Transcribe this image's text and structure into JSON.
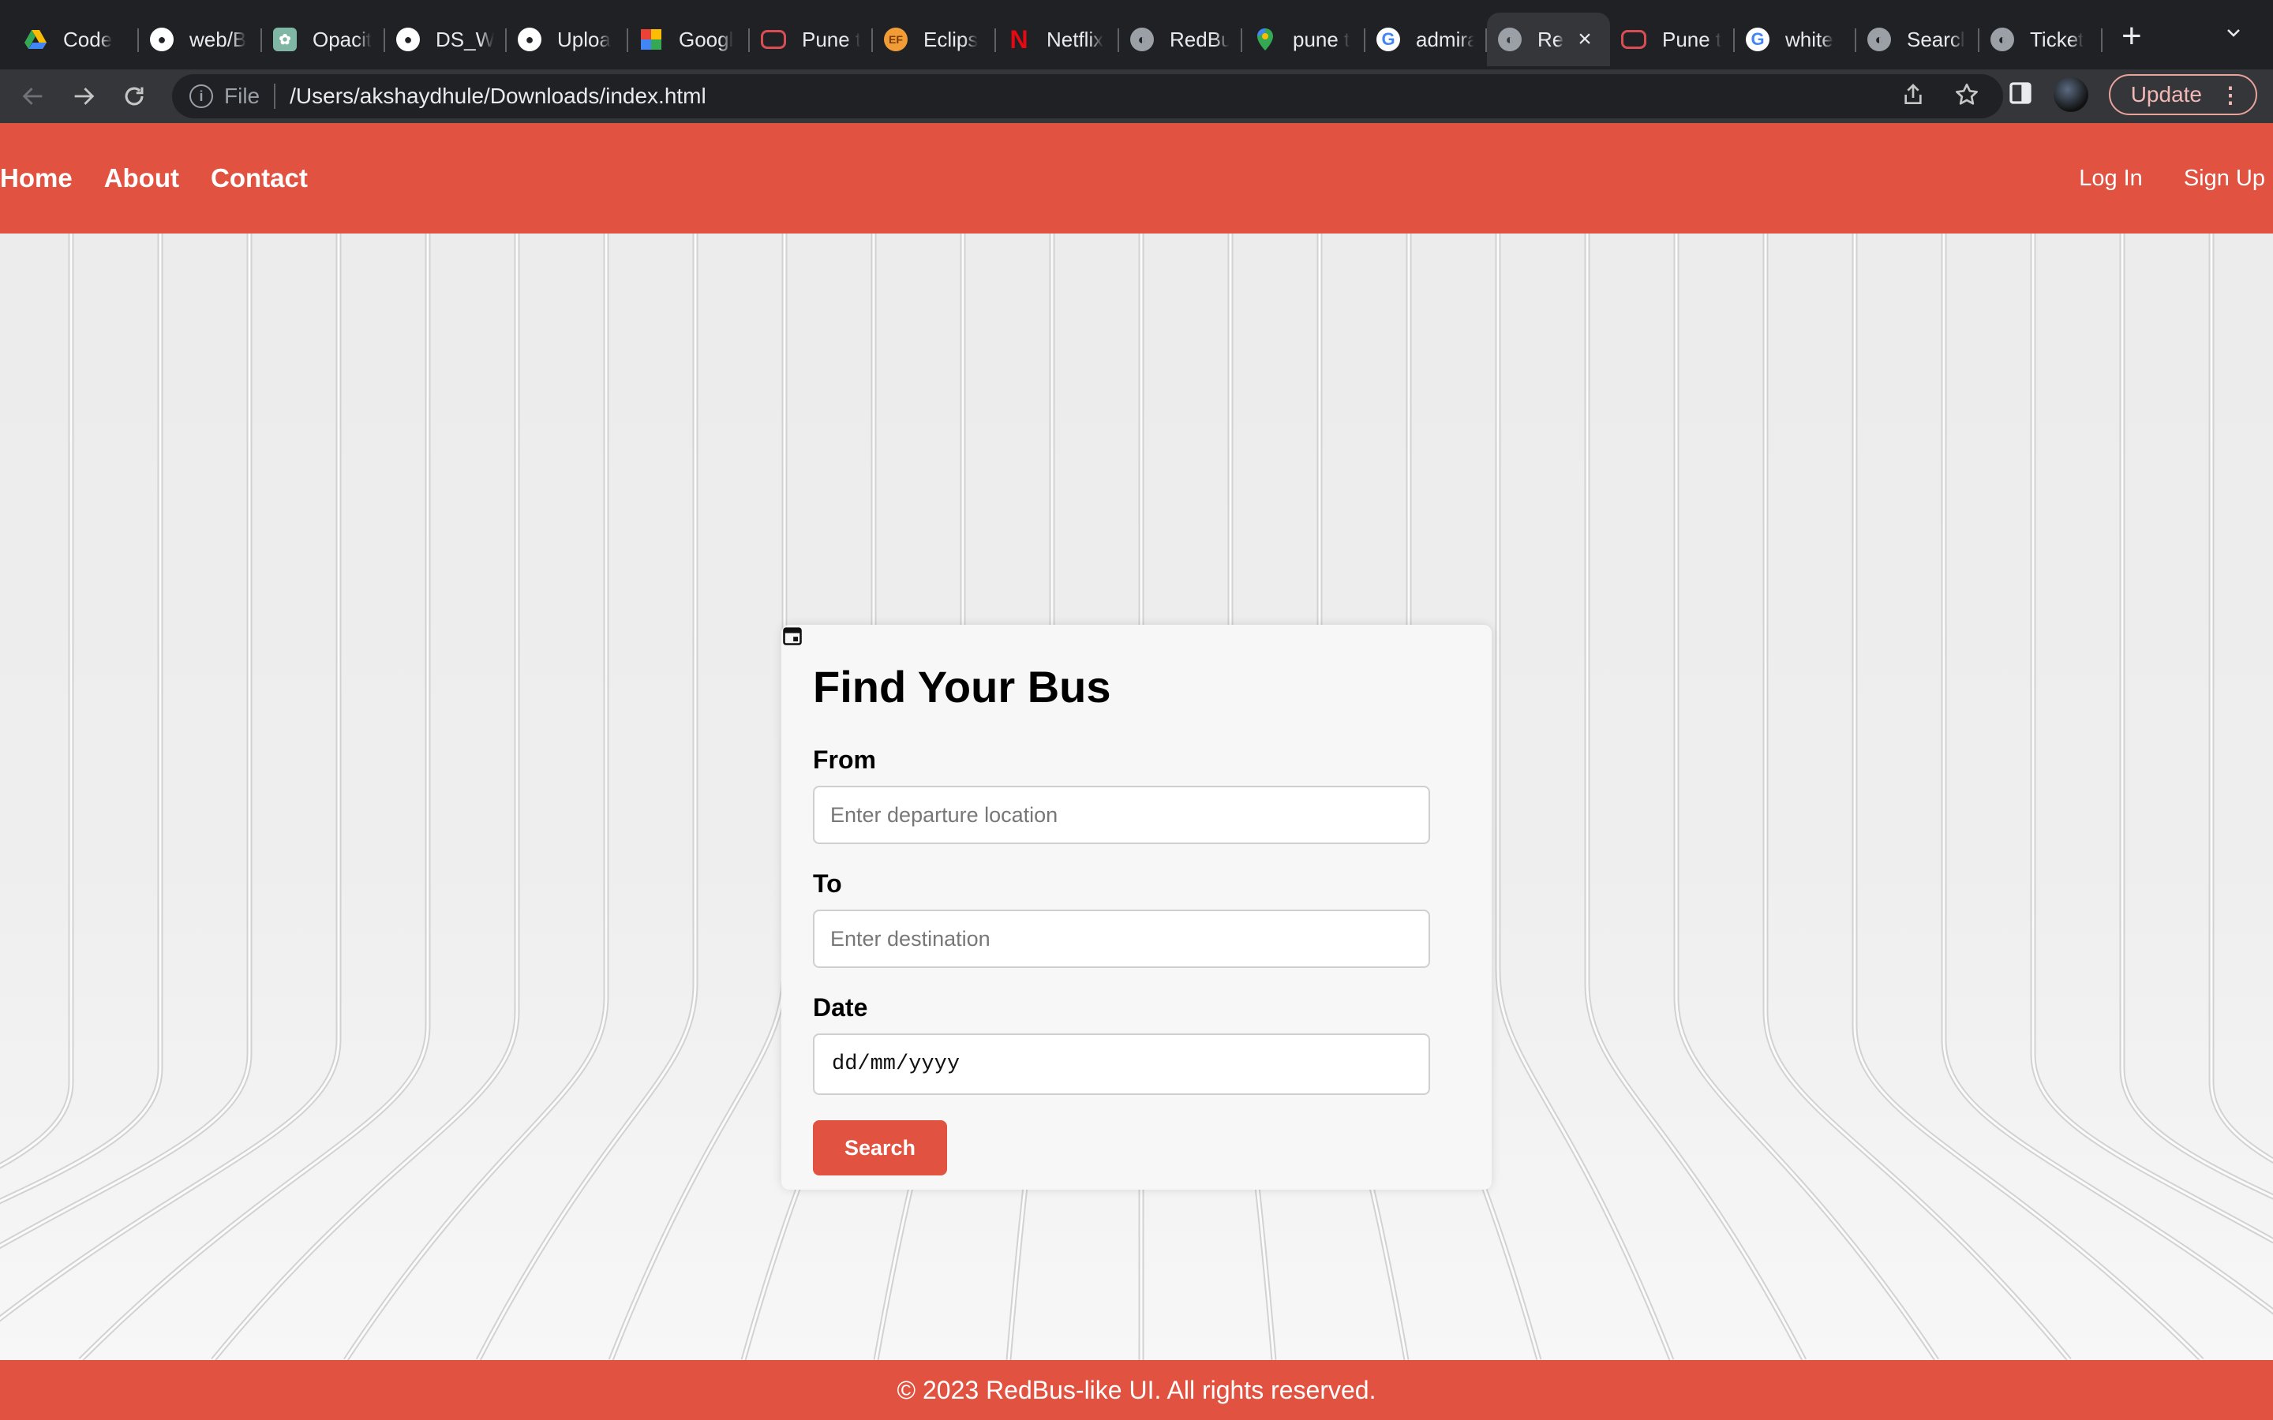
{
  "browser": {
    "tabs": [
      {
        "title": "Code",
        "favicon": "google-drive-icon"
      },
      {
        "title": "web/B",
        "favicon": "github-icon"
      },
      {
        "title": "Opacit",
        "favicon": "openai-icon"
      },
      {
        "title": "DS_W",
        "favicon": "github-icon"
      },
      {
        "title": "Uploa",
        "favicon": "github-icon"
      },
      {
        "title": "Googl",
        "favicon": "google-photos-icon"
      },
      {
        "title": "Pune t",
        "favicon": "redbus-icon"
      },
      {
        "title": "Eclips",
        "favicon": "eclipse-icon"
      },
      {
        "title": "Netflix",
        "favicon": "netflix-icon"
      },
      {
        "title": "RedBu",
        "favicon": "globe-icon"
      },
      {
        "title": "pune t",
        "favicon": "google-maps-icon"
      },
      {
        "title": "admira",
        "favicon": "google-icon"
      },
      {
        "title": "Re",
        "favicon": "globe-icon",
        "active": true
      },
      {
        "title": "Pune t",
        "favicon": "redbus-icon"
      },
      {
        "title": "white",
        "favicon": "google-icon"
      },
      {
        "title": "Searcl",
        "favicon": "globe-icon"
      },
      {
        "title": "Ticket",
        "favicon": "globe-icon"
      }
    ],
    "address": {
      "scheme_label": "File",
      "url": "/Users/akshaydhule/Downloads/index.html"
    },
    "update_label": "Update"
  },
  "site": {
    "nav_left": [
      "Home",
      "About",
      "Contact"
    ],
    "nav_right": [
      "Log In",
      "Sign Up"
    ],
    "form": {
      "title": "Find Your Bus",
      "from_label": "From",
      "from_placeholder": "Enter departure location",
      "to_label": "To",
      "to_placeholder": "Enter destination",
      "date_label": "Date",
      "date_placeholder": "dd/mm/yyyy",
      "search_label": "Search"
    },
    "footer": "© 2023 RedBus-like UI. All rights reserved.",
    "colors": {
      "brand": "#e25241",
      "chrome_dark": "#202124",
      "chrome_toolbar": "#35363a"
    }
  }
}
